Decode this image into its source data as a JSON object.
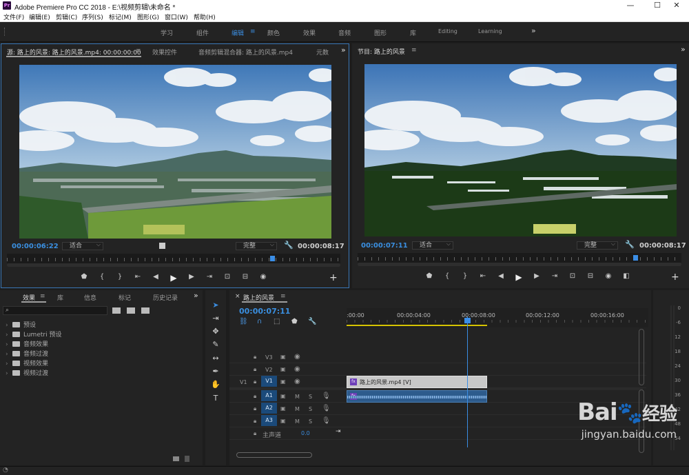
{
  "window": {
    "title": "Adobe Premiere Pro CC 2018 - E:\\视频剪辑\\未命名 *",
    "app_icon": "Pr",
    "buttons": {
      "minimize": "—",
      "maximize": "☐",
      "close": "✕"
    }
  },
  "menu": [
    "文件(F)",
    "编辑(E)",
    "剪辑(C)",
    "序列(S)",
    "标记(M)",
    "图形(G)",
    "窗口(W)",
    "帮助(H)"
  ],
  "workspaces": {
    "items": [
      "学习",
      "组件",
      "编辑",
      "颜色",
      "效果",
      "音频",
      "图形",
      "库",
      "Editing",
      "Learning"
    ],
    "active": "编辑",
    "active_menu_icon": "≡",
    "overflow": "»"
  },
  "source_monitor": {
    "tabs": [
      "源: 路上的风景: 路上的风景.mp4: 00:00:00:00",
      "效果控件",
      "音频剪辑混合器: 路上的风景.mp4",
      "元数"
    ],
    "tab_menu": "≡",
    "overflow": "»",
    "timecode": "00:00:06:22",
    "fit": "适合",
    "quality": "完整",
    "duration": "00:00:08:17",
    "playhead_fraction": 0.79
  },
  "program_monitor": {
    "title": "节目: 路上的风景",
    "tab_menu": "≡",
    "overflow": "»",
    "timecode": "00:00:07:11",
    "fit": "适合",
    "quality": "完整",
    "duration": "00:00:08:17",
    "playhead_fraction": 0.85
  },
  "transport": {
    "source": [
      "marker-icon",
      "in-point-icon",
      "out-point-icon",
      "go-to-in-icon",
      "step-back-icon",
      "play-icon",
      "step-forward-icon",
      "go-to-out-icon",
      "insert-icon",
      "overwrite-icon",
      "export-frame-icon"
    ],
    "glyphs": {
      "marker-icon": "⬟",
      "in-point-icon": "{",
      "out-point-icon": "}",
      "go-to-in-icon": "⇤",
      "step-back-icon": "◀",
      "play-icon": "▶",
      "step-forward-icon": "▶",
      "go-to-out-icon": "⇥",
      "insert-icon": "⊡",
      "overwrite-icon": "⊟",
      "export-frame-icon": "◉",
      "lift-icon": "⊡",
      "extract-icon": "⊟",
      "compare-icon": "◧",
      "add-icon": "+"
    }
  },
  "project_panel": {
    "tabs": [
      "效果",
      "库",
      "信息",
      "标记",
      "历史记录"
    ],
    "tab_menu": "≡",
    "overflow": "»",
    "search_placeholder": "",
    "items": [
      "预设",
      "Lumetri 预设",
      "音频效果",
      "音频过渡",
      "视频效果",
      "视频过渡"
    ]
  },
  "tools": [
    "selection-tool-icon",
    "track-select-icon",
    "ripple-edit-icon",
    "razor-icon",
    "slip-icon",
    "pen-icon",
    "hand-icon",
    "type-icon"
  ],
  "tool_glyphs": [
    "➤",
    "⇥",
    "✥",
    "✎",
    "↔",
    "✒",
    "✋",
    "T"
  ],
  "timeline": {
    "close": "×",
    "title": "路上的风景",
    "tab_menu": "≡",
    "timecode": "00:00:07:11",
    "ruler_labels": [
      ":00:00",
      "00:00:04:00",
      "00:00:08:00",
      "00:00:12:00",
      "00:00:16:00"
    ],
    "playhead_seconds": 7.46,
    "video_tracks": [
      {
        "name": "V3",
        "source": ""
      },
      {
        "name": "V2",
        "source": ""
      },
      {
        "name": "V1",
        "source": "V1"
      }
    ],
    "audio_tracks": [
      {
        "name": "A1",
        "m": "M",
        "s": "S"
      },
      {
        "name": "A2",
        "m": "M",
        "s": "S"
      },
      {
        "name": "A3",
        "m": "M",
        "s": "S"
      }
    ],
    "master": {
      "label": "主声道",
      "value": "0.0"
    },
    "video_clip": {
      "label": "路上的风景.mp4 [V]",
      "fx": "fx",
      "start_seconds": 0,
      "end_seconds": 8.7
    },
    "audio_clip": {
      "fx": "fx",
      "start_seconds": 0,
      "end_seconds": 8.7
    }
  },
  "audio_meter": {
    "labels": [
      "0",
      "-6",
      "-12",
      "-18",
      "-24",
      "-30",
      "-36",
      "-42",
      "-48",
      "-54"
    ]
  },
  "watermark": {
    "brand": "Bai",
    "paw": "经验",
    "site": "jingyan.baidu.com"
  },
  "colors": {
    "accent": "#3b8bdc",
    "clip_video": "#c8c8c8",
    "clip_audio": "#2f5f8f",
    "panel": "#232323",
    "yellow_bar": "#d6c400"
  }
}
